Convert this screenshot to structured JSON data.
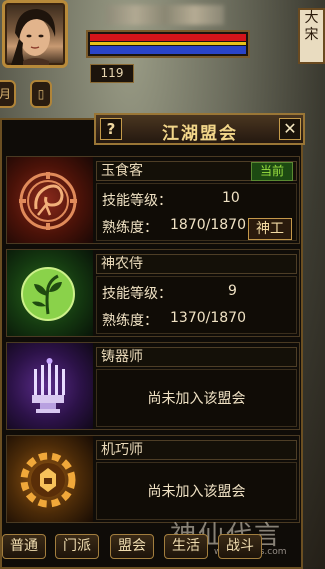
{
  "hud": {
    "level": "119",
    "side_buttons": [
      "月",
      "▯"
    ],
    "right_banner": "大宋"
  },
  "panel": {
    "help_label": "?",
    "title": "江湖盟会",
    "close_label": "✕"
  },
  "guilds": [
    {
      "name": "玉食客",
      "status": "当前",
      "skill_label": "技能等级：",
      "skill_value": "10",
      "prof_label": "熟练度：",
      "prof_value": "1870/1870",
      "action_label": "神工",
      "icon": "jade-food-emblem-icon"
    },
    {
      "name": "神农侍",
      "skill_label": "技能等级：",
      "skill_value": "9",
      "prof_label": "熟练度：",
      "prof_value": "1370/1870",
      "icon": "herb-emblem-icon"
    },
    {
      "name": "铸器师",
      "not_joined": "尚未加入该盟会",
      "icon": "forge-emblem-icon"
    },
    {
      "name": "机巧师",
      "not_joined": "尚未加入该盟会",
      "icon": "gear-emblem-icon"
    }
  ],
  "tabs": [
    "普通",
    "门派",
    "盟会",
    "生活",
    "战斗"
  ],
  "watermark": "神仙代言",
  "watermark_url": "www.9xxos.com",
  "colors": {
    "title_gold": "#f2d68a",
    "status_green": "#9ae040",
    "hp_red": "#d4141a",
    "mp_blue": "#2a44c8"
  }
}
